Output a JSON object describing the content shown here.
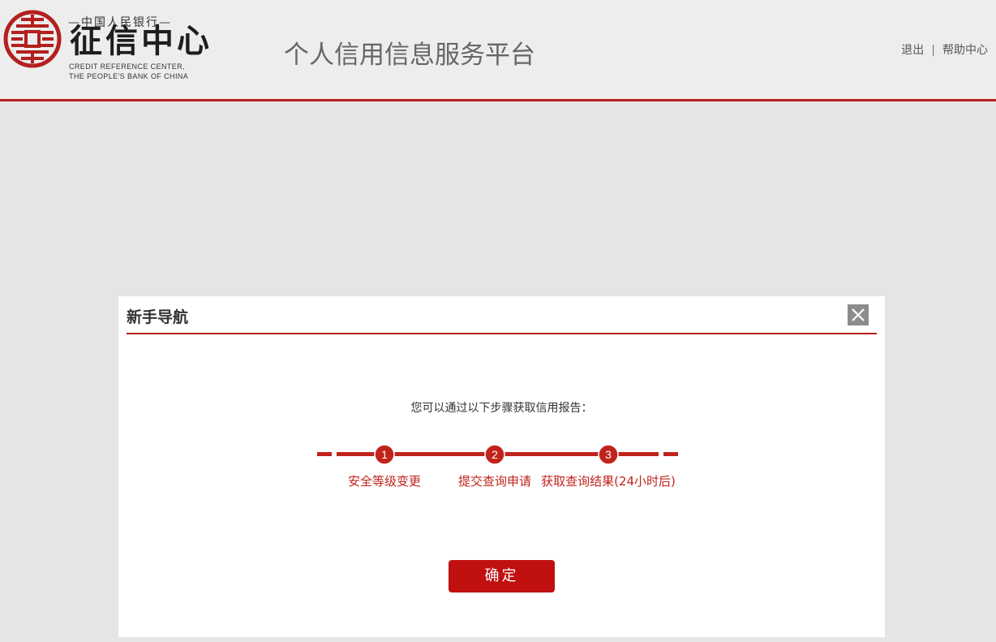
{
  "header": {
    "logo": {
      "top_text": "—中国人民银行—",
      "name": "征信中心",
      "english_line1": "CREDIT REFERENCE CENTER,",
      "english_line2": "THE PEOPLE'S BANK OF CHINA"
    },
    "platform_title": "个人信用信息服务平台",
    "links": {
      "logout": "退出",
      "separator": "|",
      "help": "帮助中心"
    }
  },
  "modal": {
    "title": "新手导航",
    "close_icon": "close-icon",
    "intro": "您可以通过以下步骤获取信用报告：",
    "steps": [
      {
        "number": "1",
        "label": "安全等级变更"
      },
      {
        "number": "2",
        "label": "提交查询申请"
      },
      {
        "number": "3",
        "label": "获取查询结果(24小时后)"
      }
    ],
    "confirm_label": "确定"
  },
  "colors": {
    "accent_red": "#b3201d",
    "button_red": "#c0100f",
    "header_bg": "#ededed",
    "page_bg": "#e5e5e5"
  }
}
